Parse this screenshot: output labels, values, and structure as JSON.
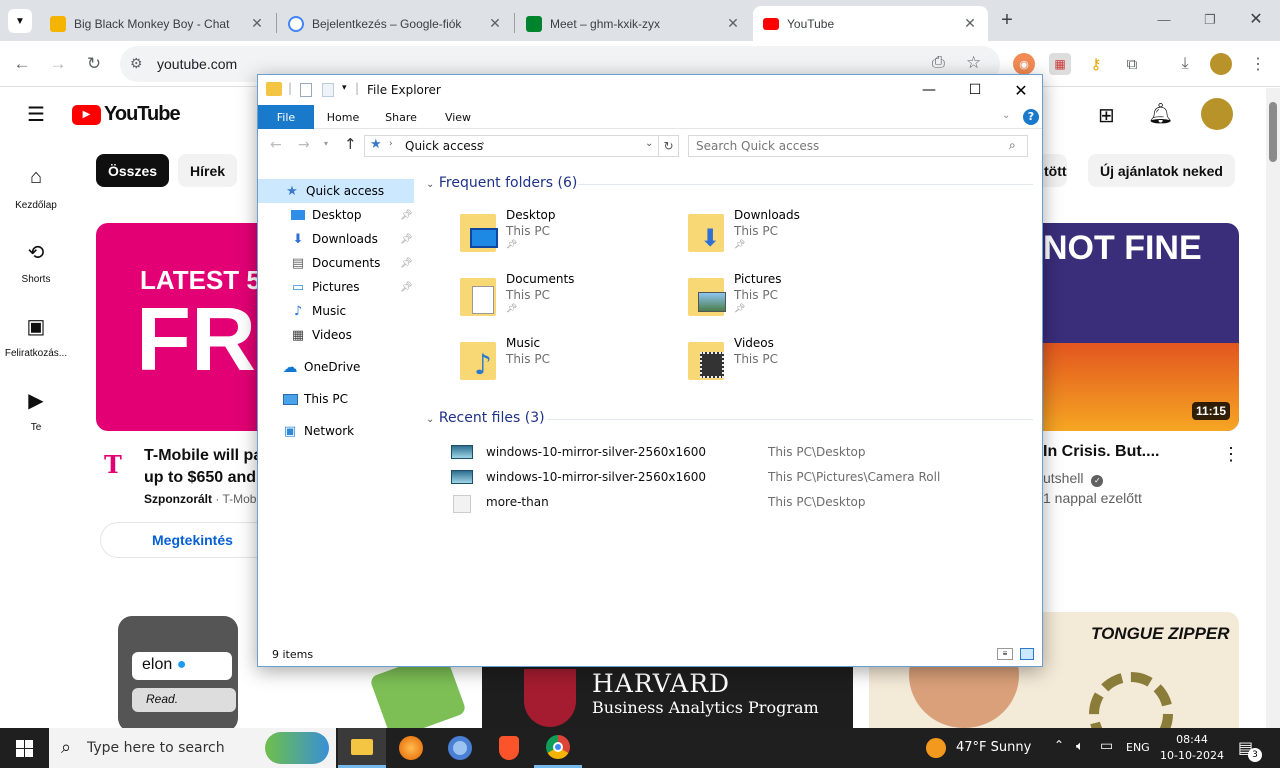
{
  "browser": {
    "tabs": [
      {
        "title": "Big Black Monkey Boy - Chat",
        "favicon_color": "#f4b400"
      },
      {
        "title": "Bejelentkezés – Google-fiók",
        "favicon_color": "#4285f4"
      },
      {
        "title": "Meet – ghm-kxik-zyx",
        "favicon_color": "#00832d"
      },
      {
        "title": "YouTube",
        "favicon_color": "#ff0000"
      }
    ],
    "url": "youtube.com"
  },
  "youtube": {
    "logo_text": "YouTube",
    "sidebar": [
      {
        "label": "Kezdőlap",
        "icon": "home-icon"
      },
      {
        "label": "Shorts",
        "icon": "shorts-icon"
      },
      {
        "label": "Feliratkozás...",
        "icon": "subscriptions-icon"
      },
      {
        "label": "Te",
        "icon": "you-icon"
      }
    ],
    "chips": [
      "Összes",
      "Hírek",
      "tött",
      "Új ajánlatok neked"
    ],
    "ad": {
      "thumb_line1": "LATEST 5G",
      "thumb_line2": "FRE",
      "title": "T-Mobile will pa… up to $650 and …",
      "title_l1": "T-Mobile will pa",
      "title_l2": "up to $650 and",
      "sponsor": "Szponzorált",
      "advertiser": "T-Mob",
      "cta": "Megtekintés"
    },
    "right_video": {
      "thumb_text": "NOT FINE",
      "duration": "11:15",
      "title": "In Crisis. But....",
      "channel": "utshell",
      "age": "1 nappal ezelőtt"
    },
    "bottom": {
      "elon": "elon",
      "read": "Read.",
      "harvard": "HARVARD",
      "harvard_sub": "Business Analytics Program",
      "tongue": "TONGUE ZIPPER"
    }
  },
  "explorer": {
    "title": "File Explorer",
    "ribbon_tabs": [
      "File",
      "Home",
      "Share",
      "View"
    ],
    "address": "Quick access",
    "search_placeholder": "Search Quick access",
    "nav": [
      {
        "label": "Quick access",
        "icon": "star-icon",
        "pin": false
      },
      {
        "label": "Desktop",
        "icon": "desktop-icon",
        "pin": true
      },
      {
        "label": "Downloads",
        "icon": "download-icon",
        "pin": true
      },
      {
        "label": "Documents",
        "icon": "document-icon",
        "pin": true
      },
      {
        "label": "Pictures",
        "icon": "pictures-icon",
        "pin": true
      },
      {
        "label": "Music",
        "icon": "music-icon",
        "pin": false
      },
      {
        "label": "Videos",
        "icon": "videos-icon",
        "pin": false
      },
      {
        "label": "OneDrive",
        "icon": "cloud-icon",
        "pin": false
      },
      {
        "label": "This PC",
        "icon": "pc-icon",
        "pin": false
      },
      {
        "label": "Network",
        "icon": "network-icon",
        "pin": false
      }
    ],
    "frequent_header": "Frequent folders (6)",
    "folders": [
      {
        "name": "Desktop",
        "location": "This PC",
        "pinned": true
      },
      {
        "name": "Downloads",
        "location": "This PC",
        "pinned": true
      },
      {
        "name": "Documents",
        "location": "This PC",
        "pinned": true
      },
      {
        "name": "Pictures",
        "location": "This PC",
        "pinned": true
      },
      {
        "name": "Music",
        "location": "This PC",
        "pinned": false
      },
      {
        "name": "Videos",
        "location": "This PC",
        "pinned": false
      }
    ],
    "recent_header": "Recent files (3)",
    "recent": [
      {
        "name": "windows-10-mirror-silver-2560x1600",
        "path": "This PC\\Desktop"
      },
      {
        "name": "windows-10-mirror-silver-2560x1600",
        "path": "This PC\\Pictures\\Camera Roll"
      },
      {
        "name": "more-than",
        "path": "This PC\\Desktop"
      }
    ],
    "status": "9 items"
  },
  "taskbar": {
    "search_placeholder": "Type here to search",
    "weather": "47°F  Sunny",
    "lang": "ENG",
    "time": "08:44",
    "date": "10-10-2024",
    "notifications": "3"
  }
}
